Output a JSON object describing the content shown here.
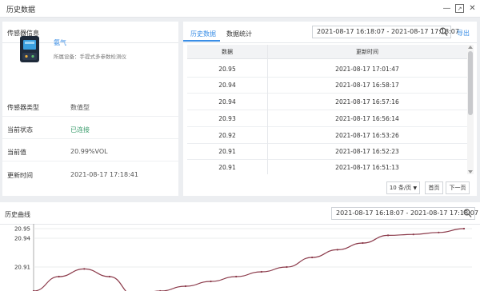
{
  "window": {
    "title": "历史数据"
  },
  "sensor_panel": {
    "title": "传感器信息",
    "device_name": "氨气",
    "device_desc": "所属设备：手提式多参数检测仪",
    "rows": [
      {
        "label": "传感器类型",
        "value": "数值型"
      },
      {
        "label": "当前状态",
        "value": "已连接"
      },
      {
        "label": "当前值",
        "value": "20.99%VOL"
      },
      {
        "label": "更新时间",
        "value": "2021-08-17 17:18:41"
      }
    ]
  },
  "history_panel": {
    "tabs": [
      "历史数据",
      "数据统计"
    ],
    "date_range": "2021-08-17 16:18:07 - 2021-08-17 17:18:07",
    "export_label": "导出",
    "columns": [
      "数据",
      "更新时间"
    ],
    "rows": [
      {
        "value": "20.95",
        "time": "2021-08-17 17:01:47"
      },
      {
        "value": "20.94",
        "time": "2021-08-17 16:58:17"
      },
      {
        "value": "20.94",
        "time": "2021-08-17 16:57:16"
      },
      {
        "value": "20.93",
        "time": "2021-08-17 16:56:14"
      },
      {
        "value": "20.92",
        "time": "2021-08-17 16:53:26"
      },
      {
        "value": "20.91",
        "time": "2021-08-17 16:52:23"
      },
      {
        "value": "20.91",
        "time": "2021-08-17 16:51:13"
      }
    ],
    "page_size": "10 条/页",
    "prev_label": "首页",
    "next_label": "下一页"
  },
  "curve_panel": {
    "title": "历史曲线",
    "date_range": "2021-08-17 16:18:07 - 2021-08-17 17:18:07"
  },
  "chart_data": {
    "type": "line",
    "title": "",
    "xlabel": "",
    "ylabel": "",
    "y_ticks": [
      "20.95",
      "20.94",
      "20.91"
    ],
    "ylim": [
      20.85,
      20.95
    ],
    "series": [
      {
        "values": [
          20.885,
          20.9,
          20.908,
          20.9,
          20.88,
          20.885,
          20.89,
          20.895,
          20.9,
          20.905,
          20.91,
          20.92,
          20.928,
          20.935,
          20.943,
          20.944,
          20.946,
          20.95
        ]
      }
    ],
    "color": "#8b3a4a",
    "grid": true
  }
}
